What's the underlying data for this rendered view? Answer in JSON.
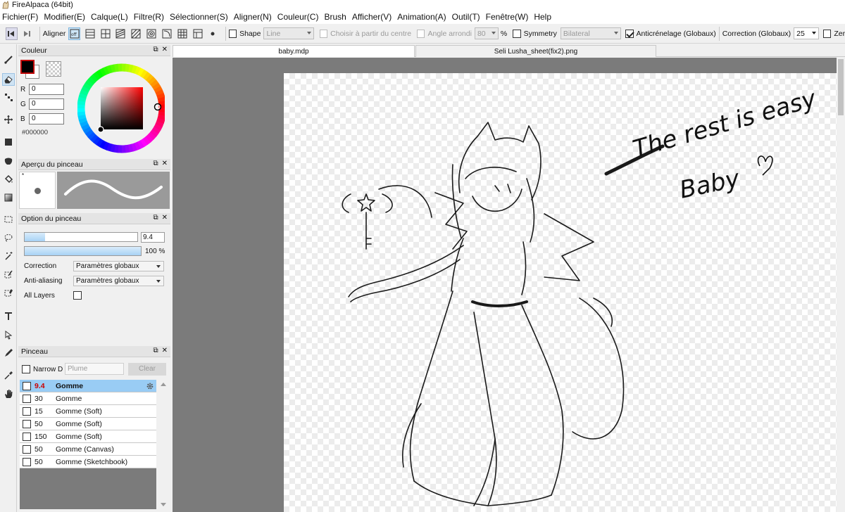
{
  "window": {
    "title": "FireAlpaca (64bit)"
  },
  "menu": [
    "Fichier(F)",
    "Modifier(E)",
    "Calque(L)",
    "Filtre(R)",
    "Sélectionner(S)",
    "Aligner(N)",
    "Couleur(C)",
    "Brush",
    "Afficher(V)",
    "Animation(A)",
    "Outil(T)",
    "Fenêtre(W)",
    "Help"
  ],
  "toolbar": {
    "align_label": "Aligner",
    "shape_label": "Shape",
    "shape_value": "Line",
    "center_label": "Choisir à partir du centre",
    "round_label": "Angle arrondi",
    "round_value": "80",
    "round_unit": "%",
    "symmetry_label": "Symmetry",
    "symmetry_value": "Bilateral",
    "antialias_label": "Anticrénelage (Globaux)",
    "correction_label": "Correction (Globaux)",
    "correction_value": "25",
    "zero_label": "Zer"
  },
  "color_panel": {
    "title": "Couleur",
    "r_label": "R",
    "r_value": "0",
    "g_label": "G",
    "g_value": "0",
    "b_label": "B",
    "b_value": "0",
    "hex": "#000000",
    "primary_color": "#000000"
  },
  "preview_panel": {
    "title": "Aperçu du pinceau"
  },
  "options_panel": {
    "title": "Option du pinceau",
    "size_value": "9.4",
    "size_fraction": 0.18,
    "opacity_value": "100 %",
    "opacity_fraction": 1.0,
    "correction_label": "Correction",
    "correction_value": "Paramètres globaux",
    "antialias_label": "Anti-aliasing",
    "antialias_value": "Paramètres globaux",
    "all_layers_label": "All Layers"
  },
  "brush_panel": {
    "title": "Pinceau",
    "narrow_label": "Narrow D",
    "search_placeholder": "Plume",
    "clear_label": "Clear",
    "items": [
      {
        "size": "9.4",
        "name": "Gomme"
      },
      {
        "size": "30",
        "name": "Gomme"
      },
      {
        "size": "15",
        "name": "Gomme (Soft)"
      },
      {
        "size": "50",
        "name": "Gomme (Soft)"
      },
      {
        "size": "150",
        "name": "Gomme (Soft)"
      },
      {
        "size": "50",
        "name": "Gomme (Canvas)"
      },
      {
        "size": "50",
        "name": "Gomme (Sketchbook)"
      }
    ]
  },
  "tabs": [
    {
      "label": "baby.mdp",
      "active": true
    },
    {
      "label": "Seli Lusha_sheet(fix2).png",
      "active": false
    }
  ],
  "canvas": {
    "handwriting_line1": "The rest is easy",
    "handwriting_line2": "Baby"
  }
}
